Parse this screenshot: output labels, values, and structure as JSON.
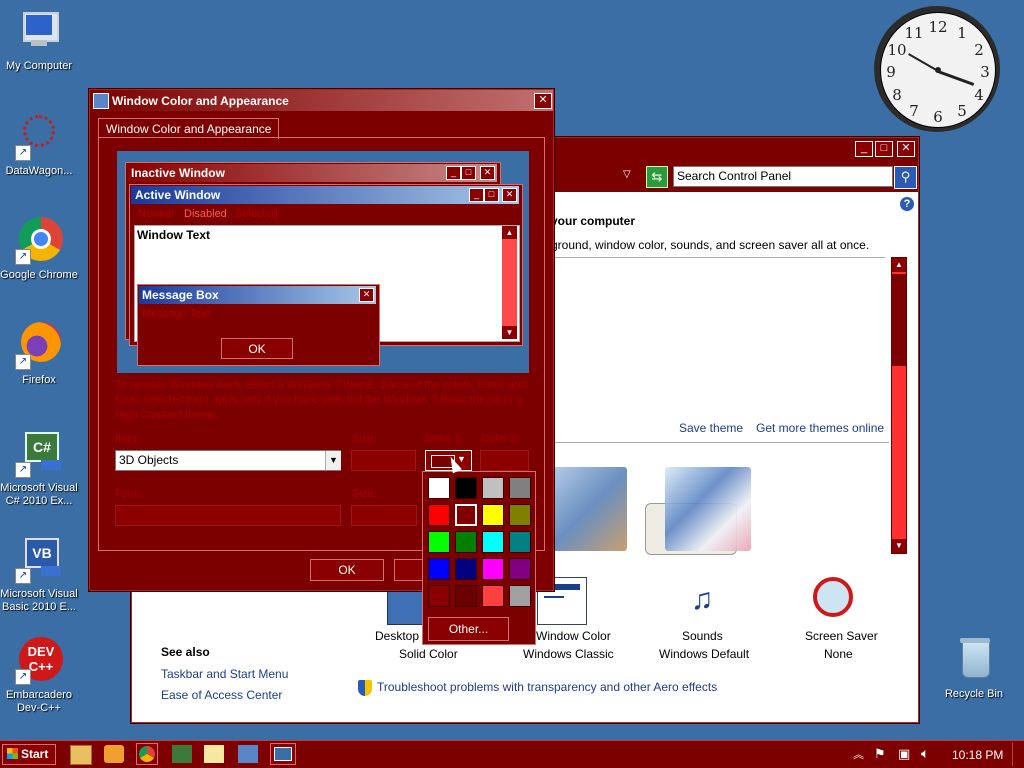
{
  "desktop": {
    "icons": [
      {
        "label": "My Computer",
        "icon": "computer-icon"
      },
      {
        "label": "DataWagon...",
        "icon": "datawagon-icon"
      },
      {
        "label": "Google Chrome",
        "icon": "chrome-icon"
      },
      {
        "label": "Firefox",
        "icon": "firefox-icon"
      },
      {
        "label": "Microsoft Visual C# 2010 Ex...",
        "icon": "visual-csharp-icon"
      },
      {
        "label": "Microsoft Visual Basic 2010 E...",
        "icon": "visual-basic-icon"
      },
      {
        "label": "Embarcadero Dev-C++",
        "icon": "devcpp-icon"
      }
    ],
    "recycle_bin": "Recycle Bin",
    "clock_numbers": [
      "12",
      "1",
      "2",
      "3",
      "4",
      "5",
      "6",
      "7",
      "8",
      "9",
      "10",
      "11"
    ]
  },
  "control_panel": {
    "search_placeholder": "Search Control Panel",
    "heading": "your computer",
    "subheading": "ground, window color, sounds, and screen saver all at once.",
    "save_theme": "Save theme",
    "get_more_themes": "Get more themes online",
    "bottom_items": [
      {
        "title": "Desktop B",
        "sub": "Solid Color"
      },
      {
        "title": "Window Color",
        "sub": "Windows Classic"
      },
      {
        "title": "Sounds",
        "sub": "Windows Default"
      },
      {
        "title": "Screen Saver",
        "sub": "None"
      }
    ],
    "see_also": "See also",
    "links": [
      "Taskbar and Start Menu",
      "Ease of Access Center"
    ],
    "troubleshoot": "Troubleshoot problems with transparency and other Aero effects"
  },
  "dialog": {
    "title": "Window Color and Appearance",
    "tab": "Window Color and Appearance",
    "preview": {
      "inactive_title": "Inactive Window",
      "active_title": "Active Window",
      "menu": [
        "Normal",
        "Disabled",
        "Selected"
      ],
      "window_text": "Window Text",
      "msgbox_title": "Message Box",
      "msgbox_text": "Message Text",
      "ok": "OK"
    },
    "description": "To remove Windows Aero, select a Windows 7 theme. Some of the colors, fonts, and sizes selected here apply only if you have selected the Windows 7 Basic theme or a High Contrast theme.",
    "item_label": "Item:",
    "item_value": "3D Objects",
    "size_label": "Size:",
    "color1_label": "Color 1:",
    "color2_label": "Color 2:",
    "font_label": "Font:",
    "font_size_label": "Size:",
    "ok": "OK",
    "cancel": "Ca"
  },
  "color_picker": {
    "colors": [
      "#ffffff",
      "#000000",
      "#c0c0c0",
      "#808080",
      "#ff0000",
      "#800000",
      "#ffff00",
      "#808000",
      "#00ff00",
      "#008000",
      "#00ffff",
      "#008080",
      "#0000ff",
      "#000080",
      "#ff00ff",
      "#800080",
      "#8a0000",
      "#6a0000",
      "#ff4040",
      "#a0a0a0"
    ],
    "other": "Other..."
  },
  "taskbar": {
    "start": "Start",
    "time": "10:18 PM"
  }
}
